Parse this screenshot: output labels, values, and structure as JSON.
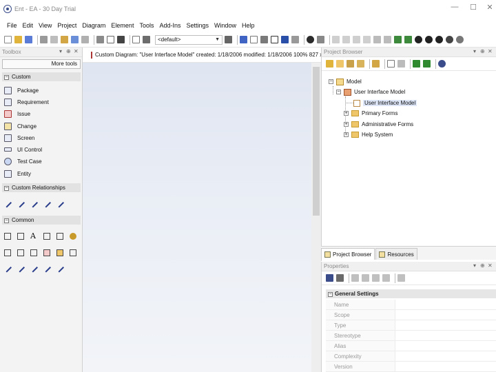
{
  "window": {
    "title": "Ent - EA - 30 Day Trial",
    "controls": [
      "—",
      "☐",
      "✕"
    ]
  },
  "menu": [
    "File",
    "Edit",
    "View",
    "Project",
    "Diagram",
    "Element",
    "Tools",
    "Add-Ins",
    "Settings",
    "Window",
    "Help"
  ],
  "toolbar": {
    "combo_value": "<default>",
    "icon_colors": [
      "#e0b43a",
      "#5a7bd6",
      "#3b3b3b",
      "#6a8fd8",
      "#8a8a8a",
      "#d2a545",
      "#6d6d6d",
      "#9a9a9a",
      "#444444",
      "#666666",
      "#3f64c4",
      "#2b2b2b",
      "#7a7a7a",
      "#999999",
      "#2a4fa8",
      "#b0b0b0"
    ]
  },
  "toolbox": {
    "header": "Toolbox",
    "more_tools": "More tools",
    "sections": {
      "custom": "Custom",
      "custom_relationships": "Custom Relationships",
      "common": "Common"
    },
    "items": [
      "Package",
      "Requirement",
      "Issue",
      "Change",
      "Screen",
      "UI Control",
      "Test Case",
      "Entity"
    ]
  },
  "diagram": {
    "tab_label": "Custom Diagram: \"User Interface Model\"  created: 1/18/2006  modified: 1/18/2006  100%  827 x"
  },
  "browser": {
    "header": "Project Browser",
    "tree": {
      "root": "Model",
      "package": "User Interface Model",
      "diagram": "User Interface Model",
      "children": [
        "Primary Forms",
        "Administrative Forms",
        "Help System"
      ]
    },
    "tabs": [
      "Project Browser",
      "Resources"
    ]
  },
  "properties": {
    "header": "Properties",
    "section": "General Settings",
    "rows": [
      "Name",
      "Scope",
      "Type",
      "Stereotype",
      "Alias",
      "Complexity",
      "Version"
    ]
  },
  "colors": {
    "accent": "#3a4c8a",
    "canvas_top": "#dfe5f1",
    "canvas_bottom": "#f2f4f8",
    "folder": "#f0c66a"
  }
}
